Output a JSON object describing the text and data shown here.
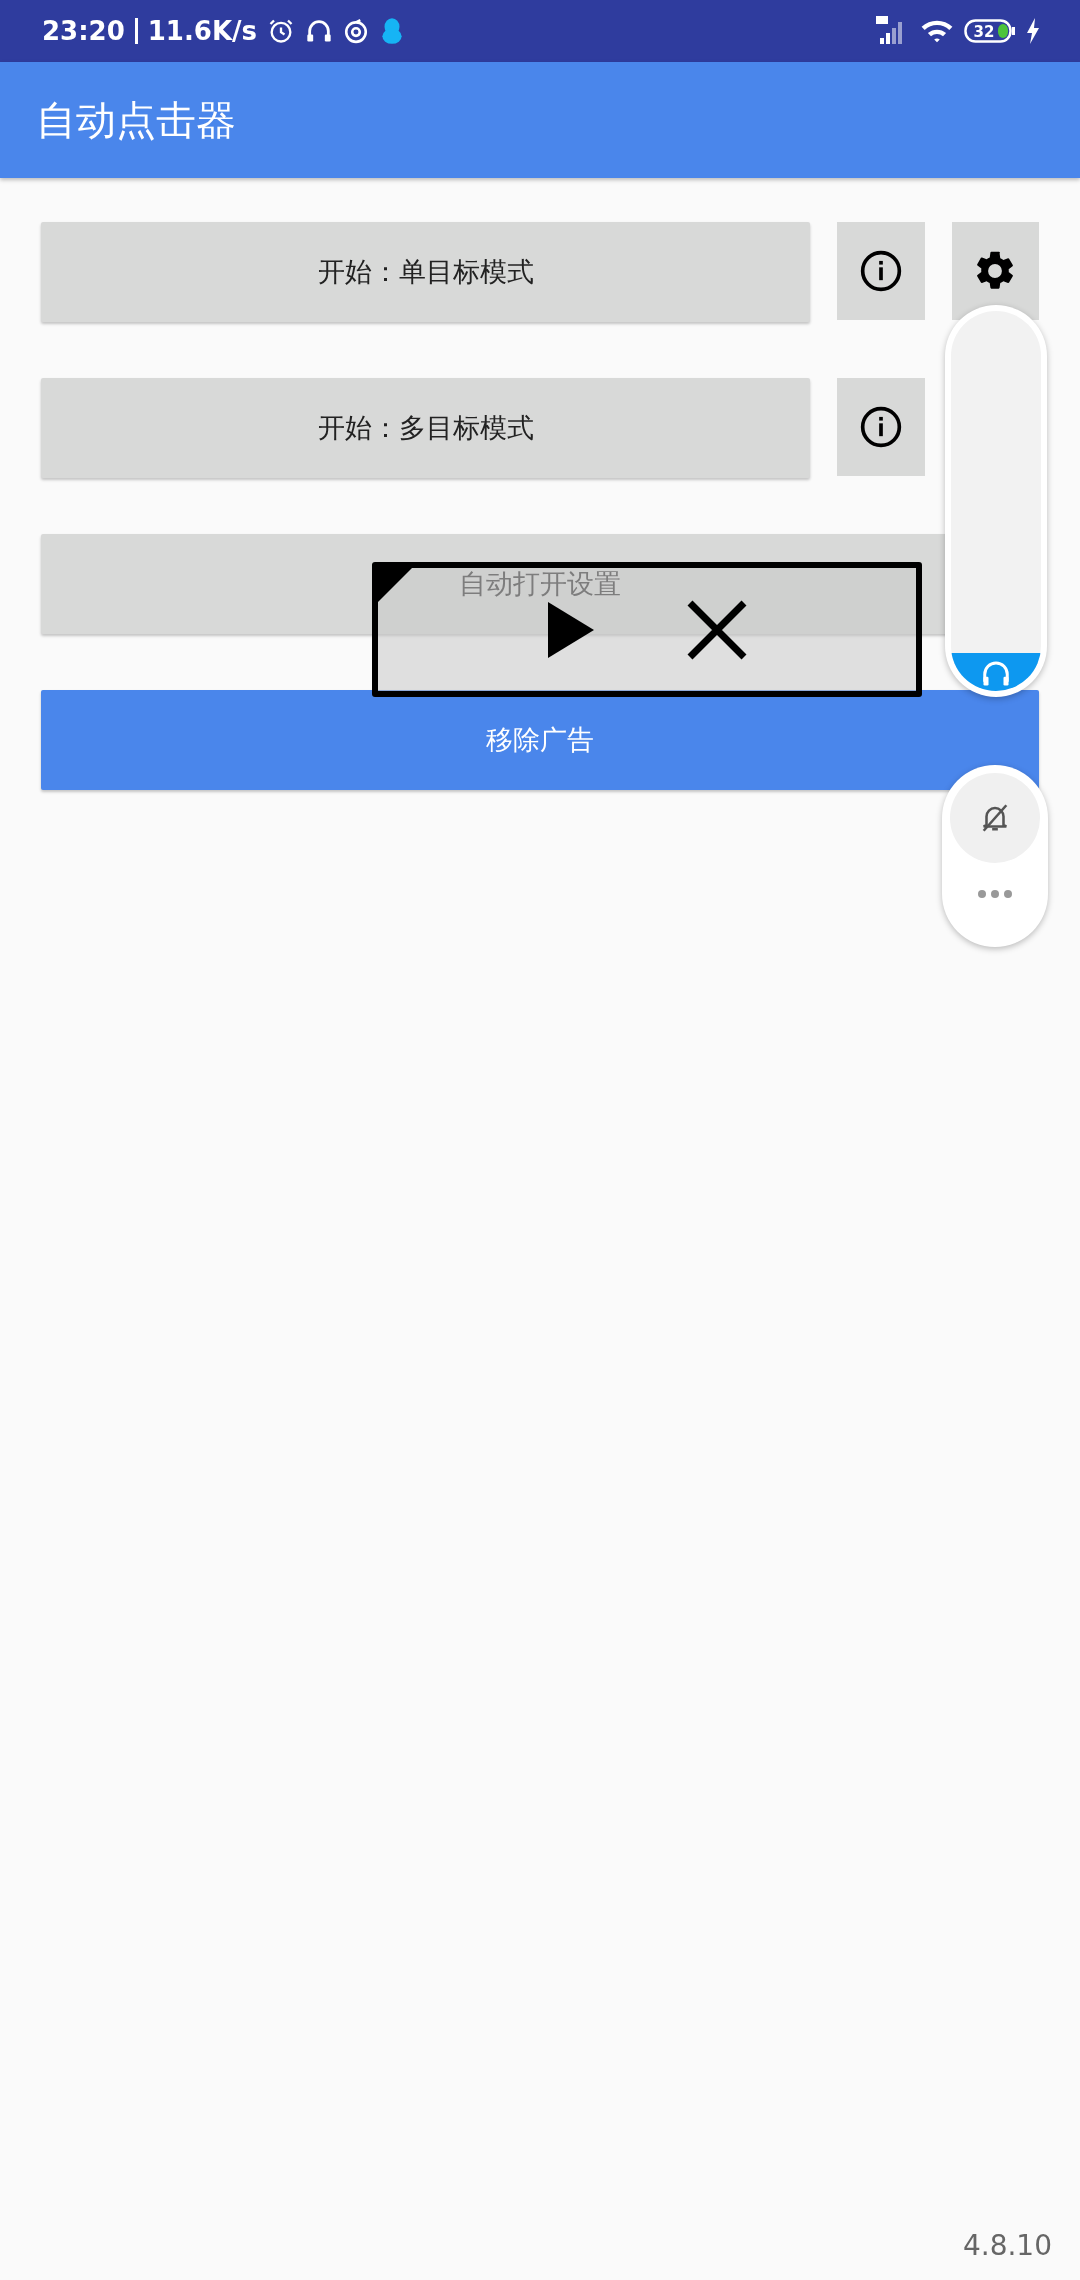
{
  "status_bar": {
    "time": "23:20",
    "network_speed": "11.6K/s",
    "battery": "32"
  },
  "app_bar": {
    "title": "自动点击器"
  },
  "buttons": [
    {
      "label": "开始：单目标模式",
      "kind": "start",
      "info_button": true,
      "settings_button": true
    },
    {
      "label": "开始：多目标模式",
      "kind": "start",
      "info_button": true,
      "settings_button": false
    },
    {
      "label": "自动打开设置",
      "kind": "wide"
    },
    {
      "label": "移除广告",
      "kind": "primary"
    }
  ],
  "volume_panel": {
    "level": 0.1
  },
  "version": "4.8.10"
}
